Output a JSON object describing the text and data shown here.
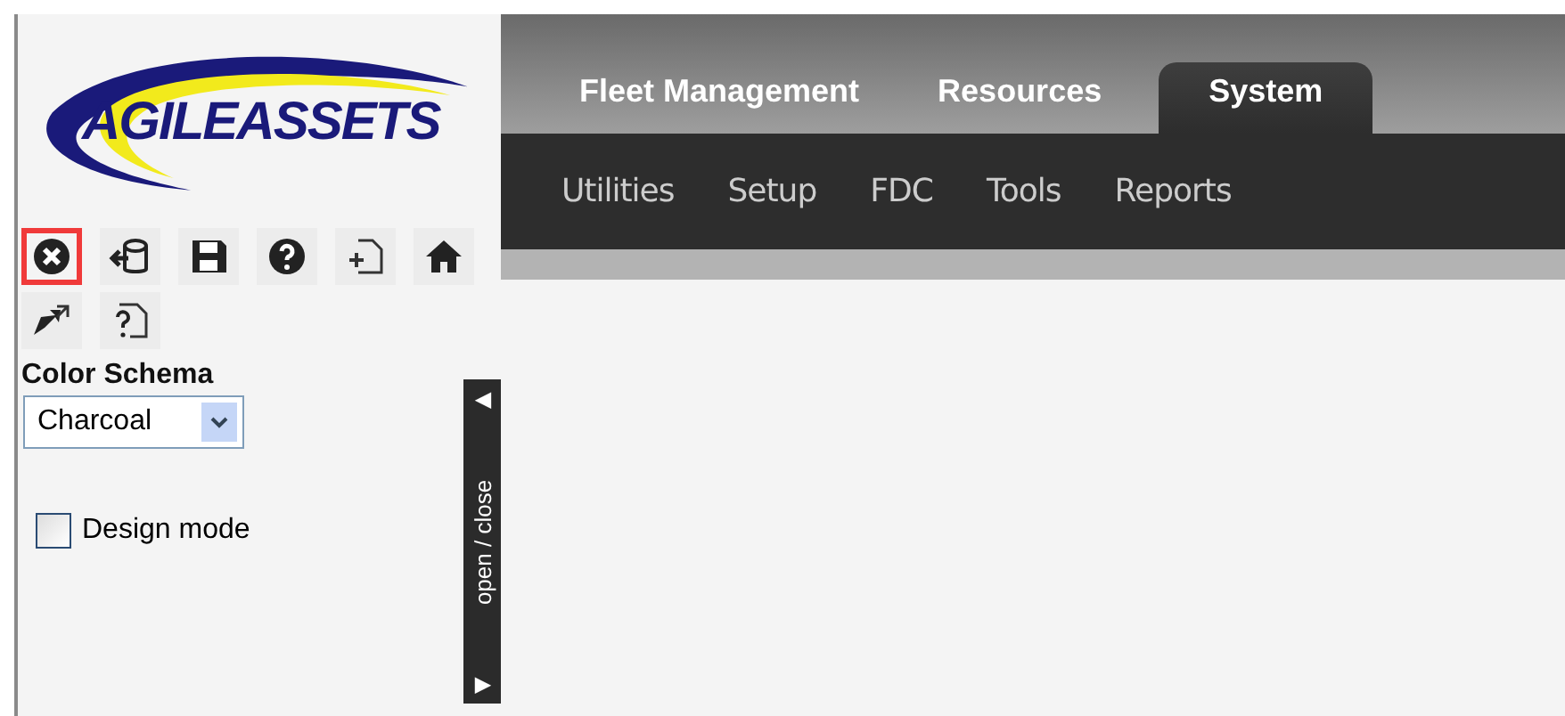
{
  "logo": {
    "text": "AGILEASSETS"
  },
  "toolbar": [
    {
      "kind": "close",
      "selected": true
    },
    {
      "kind": "exit",
      "selected": false
    },
    {
      "kind": "save",
      "selected": false
    },
    {
      "kind": "help",
      "selected": false
    },
    {
      "kind": "add-page",
      "selected": false
    },
    {
      "kind": "home",
      "selected": false
    },
    {
      "kind": "share",
      "selected": false
    },
    {
      "kind": "page-help",
      "selected": false
    }
  ],
  "color_schema": {
    "label": "Color Schema",
    "value": "Charcoal"
  },
  "design_mode": {
    "label": "Design mode",
    "checked": false
  },
  "panel_toggle": {
    "label": "open / close",
    "up": "◀",
    "down": "▶"
  },
  "tabs": [
    {
      "label": "Fleet Management",
      "selected": false
    },
    {
      "label": "Resources",
      "selected": false
    },
    {
      "label": "System",
      "selected": true
    }
  ],
  "subnav": [
    "Utilities",
    "Setup",
    "FDC",
    "Tools",
    "Reports"
  ]
}
